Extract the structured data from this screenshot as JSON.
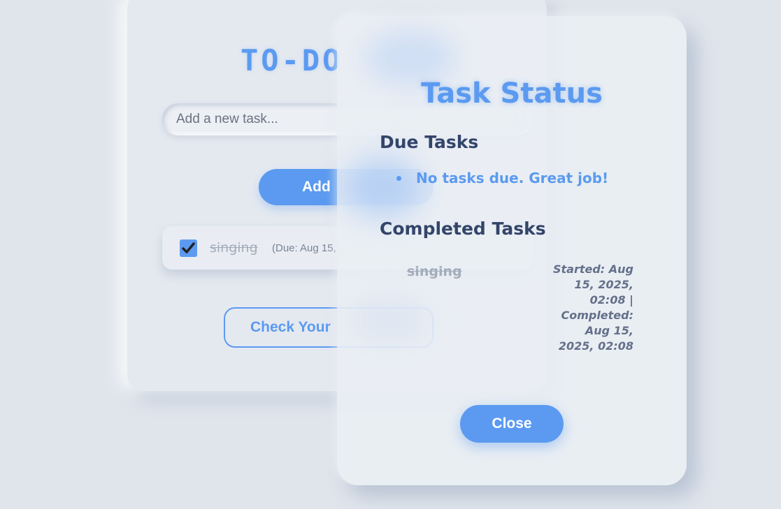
{
  "app": {
    "title": "TO-DO",
    "input_placeholder": "Add a new task...",
    "add_button": "Add",
    "check_button": "Check Your",
    "tasks": [
      {
        "text": "singing",
        "due": "(Due: Aug 15,",
        "checked": true
      }
    ],
    "icons": {
      "date": "calendar-icon",
      "check": "checkmark-icon"
    }
  },
  "modal": {
    "title": "Task Status",
    "due_heading": "Due Tasks",
    "due_items": [
      "No tasks due. Great job!"
    ],
    "completed_heading": "Completed Tasks",
    "completed_items": [
      {
        "name": "singing",
        "meta": "Started: Aug 15, 2025, 02:08 | Completed: Aug 15, 2025, 02:08"
      }
    ],
    "close_button": "Close"
  },
  "colors": {
    "accent": "#5b9af0",
    "heading": "#34456b",
    "background": "#e0e5ec"
  }
}
